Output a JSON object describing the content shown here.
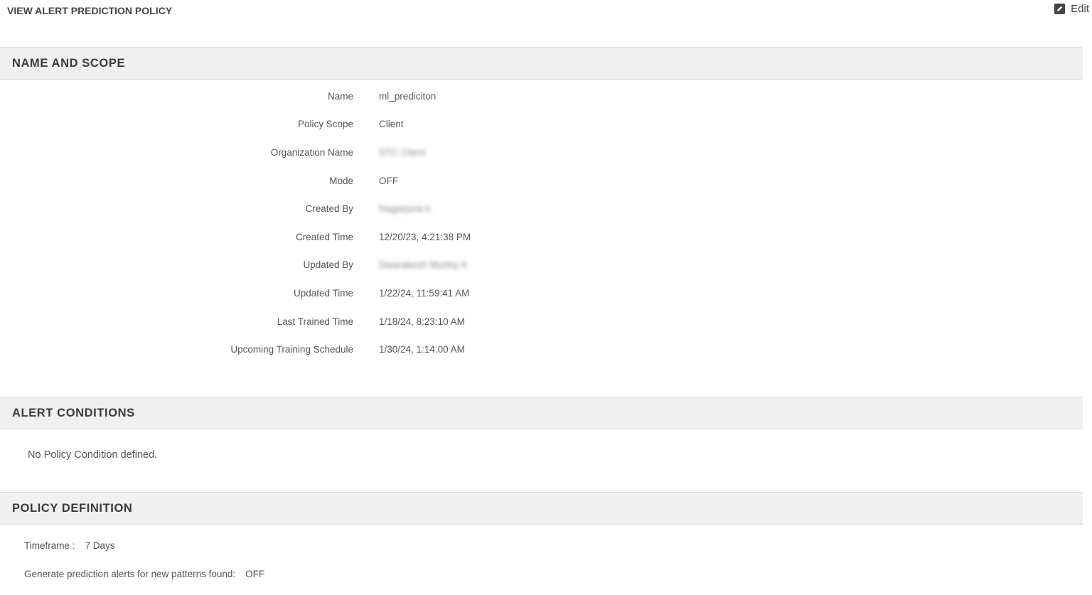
{
  "header": {
    "title": "VIEW ALERT PREDICTION POLICY",
    "edit_label": "Edit"
  },
  "name_and_scope": {
    "section_title": "NAME AND SCOPE",
    "fields": [
      {
        "label": "Name",
        "value": "ml_prediciton"
      },
      {
        "label": "Policy Scope",
        "value": "Client"
      },
      {
        "label": "Organization Name",
        "value": "STC Client"
      },
      {
        "label": "Mode",
        "value": "OFF"
      },
      {
        "label": "Created By",
        "value": "Nagarjuna k"
      },
      {
        "label": "Created Time",
        "value": "12/20/23, 4:21:38 PM"
      },
      {
        "label": "Updated By",
        "value": "Dwarakesh Murthy K"
      },
      {
        "label": "Updated Time",
        "value": "1/22/24, 11:59:41 AM"
      },
      {
        "label": "Last Trained Time",
        "value": "1/18/24, 8:23:10 AM"
      },
      {
        "label": "Upcoming Training Schedule",
        "value": "1/30/24, 1:14:00 AM"
      }
    ]
  },
  "alert_conditions": {
    "section_title": "ALERT CONDITIONS",
    "empty_message": "No Policy Condition defined."
  },
  "policy_definition": {
    "section_title": "POLICY DEFINITION",
    "timeframe_label": "Timeframe :",
    "timeframe_value": "7 Days",
    "generate_label": "Generate prediction alerts for new patterns found:",
    "generate_value": "OFF"
  }
}
